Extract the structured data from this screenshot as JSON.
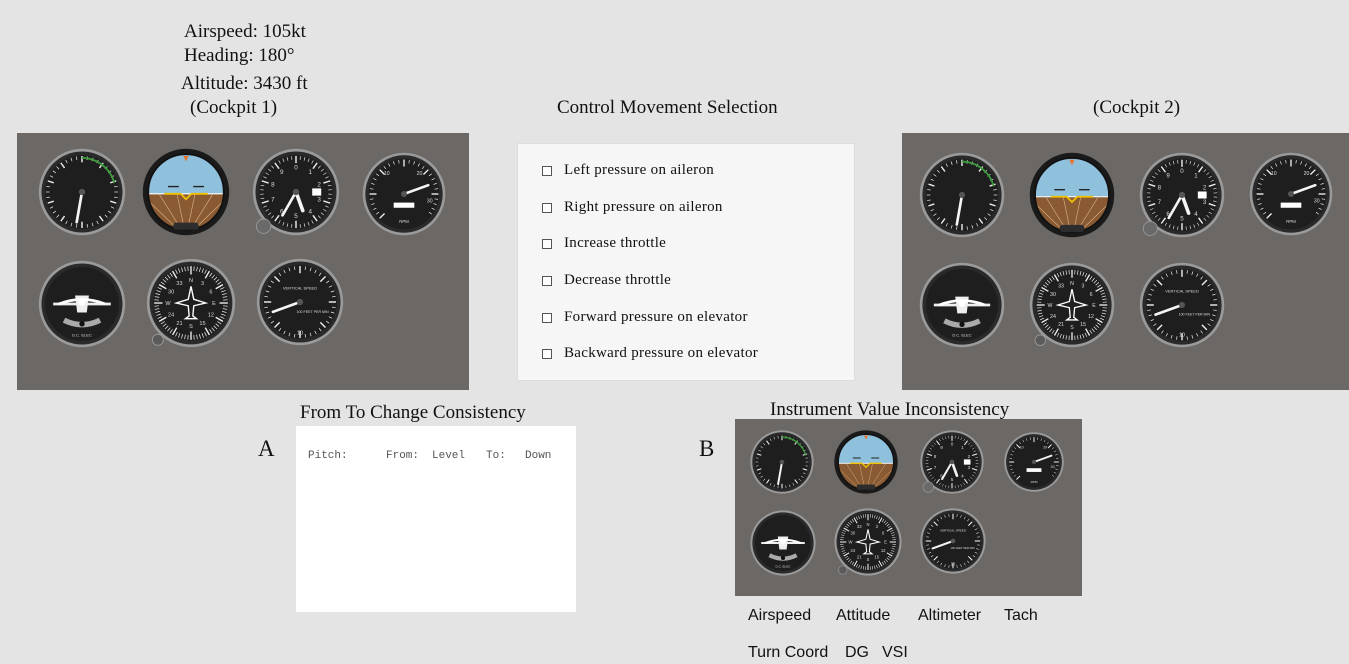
{
  "cockpit1": {
    "readout": {
      "airspeed": "Airspeed: 105kt",
      "heading": "Heading: 180°",
      "altitude": "Altitude: 3430 ft"
    },
    "title": "(Cockpit 1)"
  },
  "cockpit2": {
    "title": "(Cockpit 2)"
  },
  "control_movement": {
    "title": "Control Movement Selection",
    "options": [
      "Left pressure on aileron",
      "Right pressure on aileron",
      "Increase throttle",
      "Decrease throttle",
      "Forward pressure on elevator",
      "Backward pressure on elevator"
    ]
  },
  "panel_a": {
    "title": "From To Change Consistency",
    "letter": "A",
    "row": {
      "label": "Pitch:",
      "from_label": "From:",
      "from_value": "Level",
      "to_label": "To:",
      "to_value": "Down"
    }
  },
  "panel_b": {
    "title": "Instrument Value Inconsistency",
    "letter": "B",
    "legend_row1": [
      "Airspeed",
      "Attitude",
      "Altimeter",
      "Tach"
    ],
    "legend_row2": [
      "Turn Coord",
      "DG",
      "VSI"
    ]
  },
  "instrument_icons": [
    "airspeed-indicator-icon",
    "attitude-indicator-icon",
    "altimeter-icon",
    "tachometer-icon",
    "turn-coordinator-icon",
    "directional-gyro-icon",
    "vertical-speed-indicator-icon"
  ],
  "colors": {
    "background": "#e4e4e4",
    "panel": "#6b6866",
    "sky": "#8fc0dc",
    "ground": "#8a5a32",
    "gauge_face": "#1e1e1e"
  }
}
